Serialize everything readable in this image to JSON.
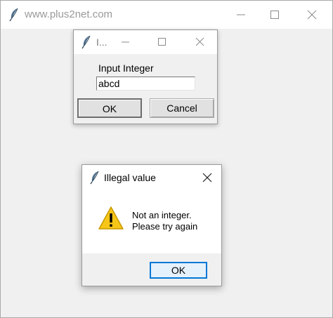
{
  "main_window": {
    "title": "www.plus2net.com",
    "icon": "feather-icon",
    "controls": [
      "minimize-icon",
      "maximize-icon",
      "close-icon"
    ]
  },
  "input_dialog": {
    "title": "I...",
    "icon": "feather-icon",
    "controls": [
      "minimize-icon",
      "maximize-icon",
      "close-icon"
    ],
    "label": "Input Integer",
    "field_value": "abcd",
    "ok_label": "OK",
    "cancel_label": "Cancel"
  },
  "error_dialog": {
    "title": "Illegal value",
    "icon": "feather-icon",
    "close": "close-icon",
    "warning_icon": "warning-icon",
    "message_line1": "Not an integer.",
    "message_line2": "Please try again",
    "ok_label": "OK"
  },
  "colors": {
    "window_bg": "#f0f0f0",
    "titlebar_bg": "#ffffff",
    "focus_border": "#0078d7",
    "warning_yellow": "#f5c518"
  }
}
